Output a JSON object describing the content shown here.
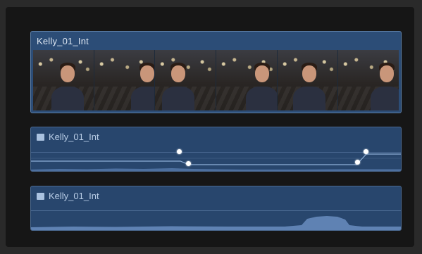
{
  "timeline": {
    "video_clip": {
      "label": "Kelly_01_Int",
      "thumbnail_count": 6
    },
    "audio_clips": [
      {
        "label": "Kelly_01_Int",
        "keyframes": 4
      },
      {
        "label": "Kelly_01_Int",
        "keyframes": 0
      }
    ]
  },
  "colors": {
    "clip_blue": "#2c4d77",
    "audio_blue": "#28466d",
    "keyframe": "#ffffff",
    "background": "#161616"
  }
}
